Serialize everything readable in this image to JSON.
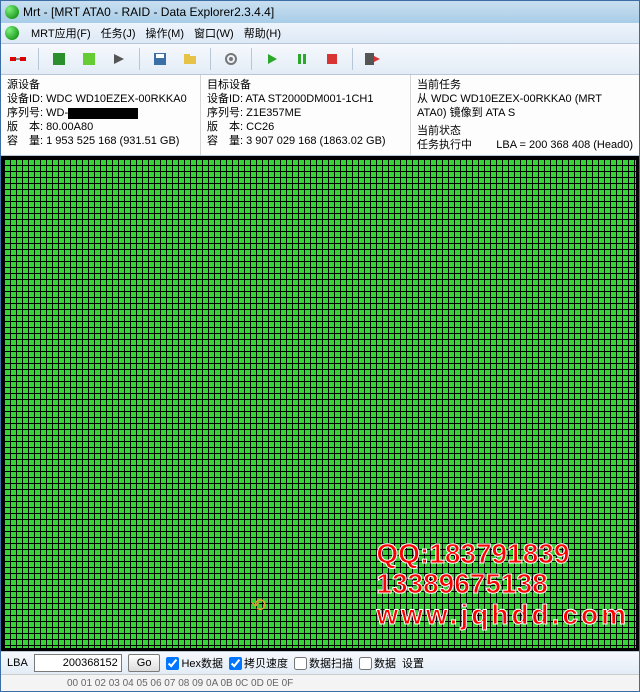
{
  "window": {
    "title": "Mrt - [MRT ATA0 - RAID - Data Explorer2.3.4.4]"
  },
  "menu": {
    "app": "MRT应用(F)",
    "task": "任务(J)",
    "operate": "操作(M)",
    "window": "窗口(W)",
    "help": "帮助(H)"
  },
  "source": {
    "header": "源设备",
    "id_lbl": "设备ID:",
    "id": "WDC WD10EZEX-00RKKA0",
    "sn_lbl": "序列号:",
    "sn_prefix": "WD-",
    "ver_lbl": "版　本:",
    "ver": "80.00A80",
    "cap_lbl": "容　量:",
    "cap": "1 953 525 168 (931.51 GB)"
  },
  "target": {
    "header": "目标设备",
    "id_lbl": "设备ID:",
    "id": "ATA ST2000DM001-1CH1",
    "sn_lbl": "序列号:",
    "sn": "Z1E357ME",
    "ver_lbl": "版　本:",
    "ver": "CC26",
    "cap_lbl": "容　量:",
    "cap": "3 907 029 168 (1863.02 GB)"
  },
  "task": {
    "header": "当前任务",
    "desc": "从 WDC WD10EZEX-00RKKA0 (MRT ATA0) 镜像到 ATA S",
    "status_hdr": "当前状态",
    "status": "任务执行中",
    "lba": "LBA = 200 368 408 (Head0)"
  },
  "bottom": {
    "lba_lbl": "LBA",
    "lba_val": "200368152",
    "go": "Go",
    "hex": "Hex数据",
    "speed": "拷贝速度",
    "scan": "数据扫描",
    "unk": "数据",
    "set": "设置"
  },
  "hexline": "00 01 02 03 04 05 06 07 08 09 0A 0B 0C 0D 0E 0F",
  "watermark": {
    "qq": "QQ:183791839",
    "phone": "13389675138",
    "url": "www.jqhdd.com"
  }
}
